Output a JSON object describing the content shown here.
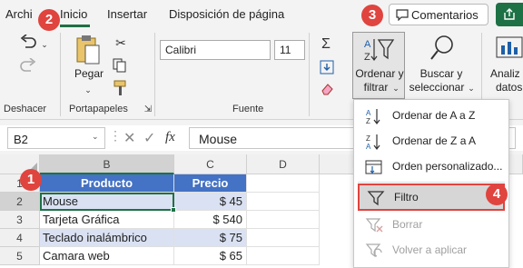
{
  "tabs": [
    {
      "label": "Archi"
    },
    {
      "label": "Inicio"
    },
    {
      "label": "Insertar"
    },
    {
      "label": "Disposición de página"
    }
  ],
  "comments_label": "Comentarios",
  "ribbon": {
    "groups": {
      "undo": "Deshacer",
      "clipboard": "Portapapeles",
      "font": "Fuente"
    },
    "paste_label": "Pegar",
    "font_name": "Calibri",
    "font_size": "11",
    "sort_filter_label_1": "Ordenar y",
    "sort_filter_label_2": "filtrar",
    "find_label_1": "Buscar y",
    "find_label_2": "seleccionar",
    "analyze_label_1": "Analiz",
    "analyze_label_2": "datos"
  },
  "formula_bar": {
    "name_box": "B2",
    "fx": "fx",
    "value": "Mouse"
  },
  "grid": {
    "columns": [
      "B",
      "C",
      "D",
      "E"
    ],
    "rows": [
      "1",
      "2",
      "3",
      "4",
      "5"
    ],
    "headers": [
      "Producto",
      "Precio"
    ],
    "data": [
      {
        "producto": "Mouse",
        "precio": "$ 45"
      },
      {
        "producto": "Tarjeta Gráfica",
        "precio": "$ 540"
      },
      {
        "producto": "Teclado inalámbrico",
        "precio": "$ 75"
      },
      {
        "producto": "Camara web",
        "precio": "$ 65"
      }
    ]
  },
  "menu": {
    "items": [
      {
        "label": "Ordenar de A a Z",
        "icon": "sort-az-icon",
        "disabled": false
      },
      {
        "label": "Ordenar de Z a A",
        "icon": "sort-za-icon",
        "disabled": false
      },
      {
        "label": "Orden personalizado...",
        "icon": "custom-sort-icon",
        "disabled": false
      },
      {
        "label": "Filtro",
        "icon": "filter-icon",
        "disabled": false
      },
      {
        "label": "Borrar",
        "icon": "clear-filter-icon",
        "disabled": true
      },
      {
        "label": "Volver a aplicar",
        "icon": "reapply-icon",
        "disabled": true
      }
    ]
  },
  "callouts": [
    "1",
    "2",
    "3",
    "4"
  ],
  "colors": {
    "accent_green": "#1e7145",
    "header_blue": "#4472c4",
    "band_blue": "#d9e1f2",
    "callout_red": "#e0443e"
  }
}
